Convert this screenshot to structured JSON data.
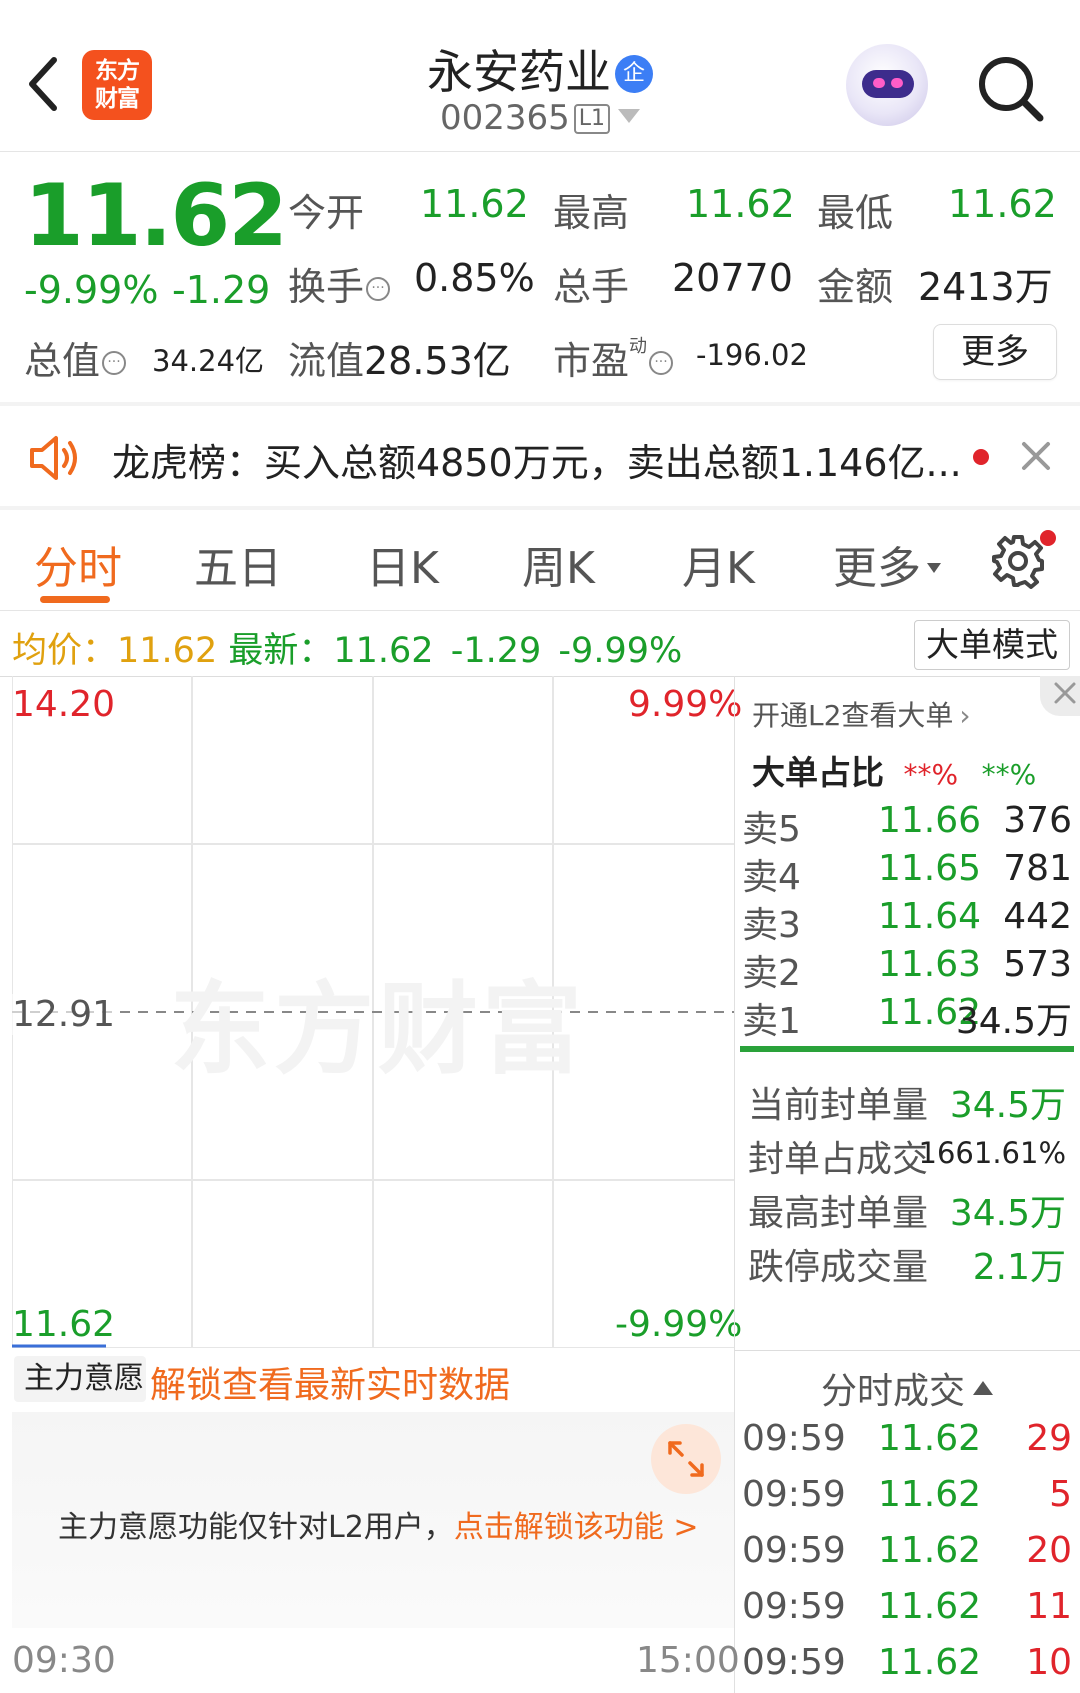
{
  "header": {
    "logo_text": "东方财富",
    "stock_name": "永安药业",
    "enterprise_badge": "企",
    "stock_code": "002365",
    "level_badge": "L1"
  },
  "quote": {
    "price": "11.62",
    "change_pct": "-9.99%",
    "change": "-1.29",
    "open_label": "今开",
    "open_value": "11.62",
    "high_label": "最高",
    "high_value": "11.62",
    "low_label": "最低",
    "low_value": "11.62",
    "turnover_label": "换手",
    "turnover_value": "0.85%",
    "volume_label": "总手",
    "volume_value": "20770",
    "amount_label": "金额",
    "amount_value": "2413万",
    "mktcap_label": "总值",
    "mktcap_value": "34.24亿",
    "float_label": "流值",
    "float_value": "28.53亿",
    "pe_label": "市盈",
    "pe_superscript": "动",
    "pe_value": "-196.02",
    "more_button": "更多"
  },
  "announcement": {
    "text": "龙虎榜：买入总额4850万元，卖出总额1.146亿..."
  },
  "tabs": [
    {
      "label": "分时",
      "active": true
    },
    {
      "label": "五日"
    },
    {
      "label": "日K"
    },
    {
      "label": "周K"
    },
    {
      "label": "月K"
    },
    {
      "label": "更多"
    }
  ],
  "avg_line": {
    "avg_label": "均价：",
    "avg_value": "11.62",
    "latest_label": "最新：",
    "latest_value": "11.62",
    "change": "-1.29",
    "change_pct": "-9.99%",
    "mode_button": "大单模式"
  },
  "chart": {
    "price_top": "14.20",
    "pct_top": "9.99%",
    "price_mid": "12.91",
    "price_bottom": "11.62",
    "pct_bottom": "-9.99%",
    "watermark": "东方财富"
  },
  "order_book": {
    "l2_link": "开通L2查看大单",
    "big_ratio_label": "大单占比",
    "big_ratio_red": "**%",
    "big_ratio_green": "**%",
    "asks": [
      {
        "label": "卖5",
        "price": "11.66",
        "volume": "376"
      },
      {
        "label": "卖4",
        "price": "11.65",
        "volume": "781"
      },
      {
        "label": "卖3",
        "price": "11.64",
        "volume": "442"
      },
      {
        "label": "卖2",
        "price": "11.63",
        "volume": "573"
      },
      {
        "label": "卖1",
        "price": "11.62",
        "volume": "34.5万"
      }
    ],
    "seal": [
      {
        "label": "当前封单量",
        "value": "34.5万"
      },
      {
        "label": "封单占成交",
        "value": "1661.61%"
      },
      {
        "label": "最高封单量",
        "value": "34.5万"
      },
      {
        "label": "跌停成交量",
        "value": "2.1万"
      }
    ]
  },
  "bottom": {
    "selector": "主力意愿",
    "unlock_title": "解锁查看最新实时数据",
    "locked_text": "主力意愿功能仅针对L2用户，",
    "locked_link": "点击解锁该功能 >",
    "time_start": "09:30",
    "time_end": "15:00"
  },
  "trades": {
    "title": "分时成交",
    "rows": [
      {
        "time": "09:59",
        "price": "11.62",
        "volume": "29"
      },
      {
        "time": "09:59",
        "price": "11.62",
        "volume": "5"
      },
      {
        "time": "09:59",
        "price": "11.62",
        "volume": "20"
      },
      {
        "time": "09:59",
        "price": "11.62",
        "volume": "11"
      },
      {
        "time": "09:59",
        "price": "11.62",
        "volume": "10"
      }
    ]
  },
  "colors": {
    "down_green": "#1a9e2a",
    "up_red": "#e0242b",
    "accent_orange": "#f06a1e",
    "avg_yellow": "#e0a10f"
  }
}
